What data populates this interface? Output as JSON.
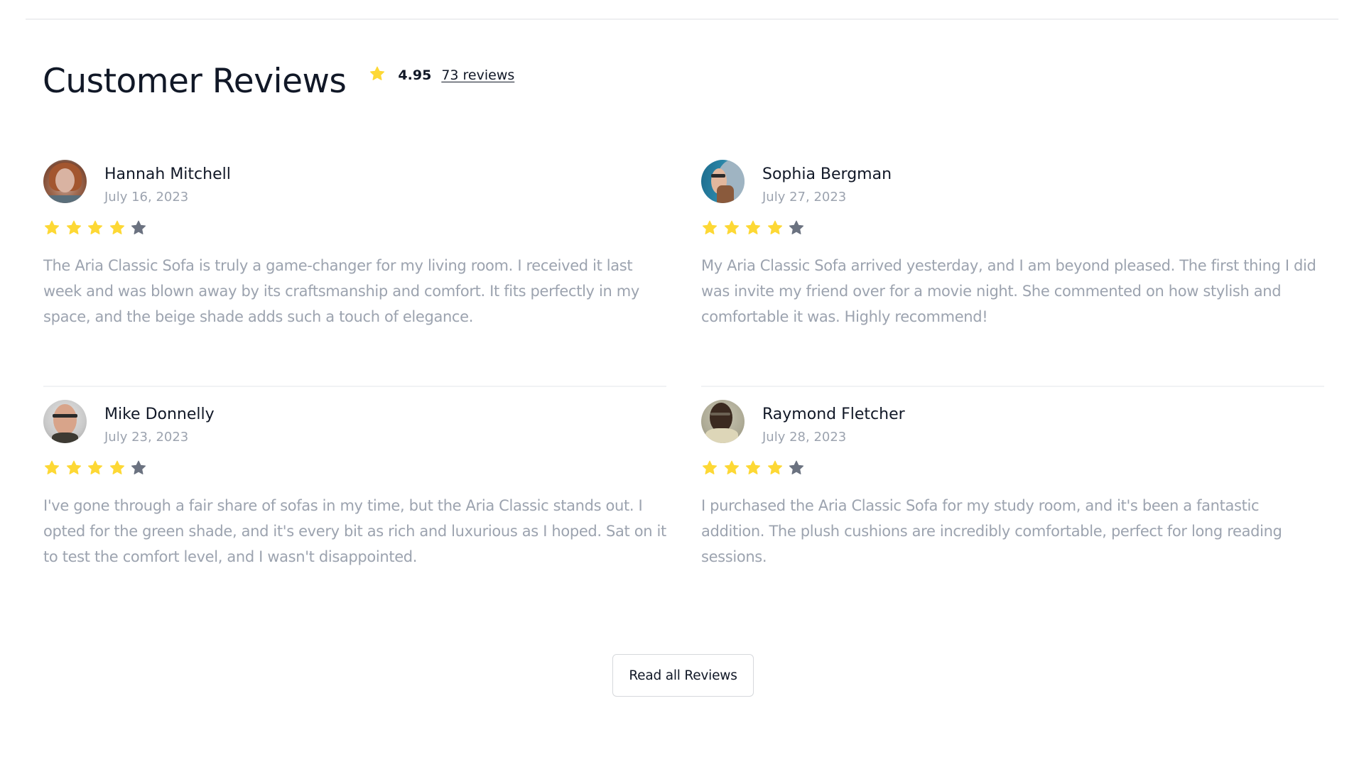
{
  "header": {
    "title": "Customer Reviews",
    "rating_value": "4.95",
    "reviews_link": "73 reviews",
    "star_icon": "star-icon"
  },
  "colors": {
    "star_filled": "#FDD835",
    "star_empty": "#6B7280",
    "title_text": "#111827",
    "muted_text": "#9CA3AF"
  },
  "reviews": [
    {
      "name": "Hannah Mitchell",
      "date": "July 16, 2023",
      "rating": 4,
      "max_rating": 5,
      "text": "The Aria Classic Sofa is truly a game-changer for my living room. I received it last week and was blown away by its craftsmanship and comfort. It fits perfectly in my space, and the beige shade adds such a touch of elegance.",
      "avatar": "avatar-hannah-mitchell"
    },
    {
      "name": "Sophia Bergman",
      "date": "July 27, 2023",
      "rating": 4,
      "max_rating": 5,
      "text": "My Aria Classic Sofa arrived yesterday, and I am beyond pleased. The first thing I did was invite my friend over for a movie night. She commented on how stylish and comfortable it was. Highly recommend!",
      "avatar": "avatar-sophia-bergman"
    },
    {
      "name": "Mike Donnelly",
      "date": "July 23, 2023",
      "rating": 4,
      "max_rating": 5,
      "text": "I've gone through a fair share of sofas in my time, but the Aria Classic stands out. I opted for the green shade, and it's every bit as rich and luxurious as I hoped. Sat on it to test the comfort level, and I wasn't disappointed.",
      "avatar": "avatar-mike-donnelly"
    },
    {
      "name": "Raymond Fletcher",
      "date": "July 28, 2023",
      "rating": 4,
      "max_rating": 5,
      "text": "I purchased the Aria Classic Sofa for my study room, and it's been a fantastic addition. The plush cushions are incredibly comfortable, perfect for long reading sessions.",
      "avatar": "avatar-raymond-fletcher"
    }
  ],
  "actions": {
    "read_all_label": "Read all Reviews"
  }
}
